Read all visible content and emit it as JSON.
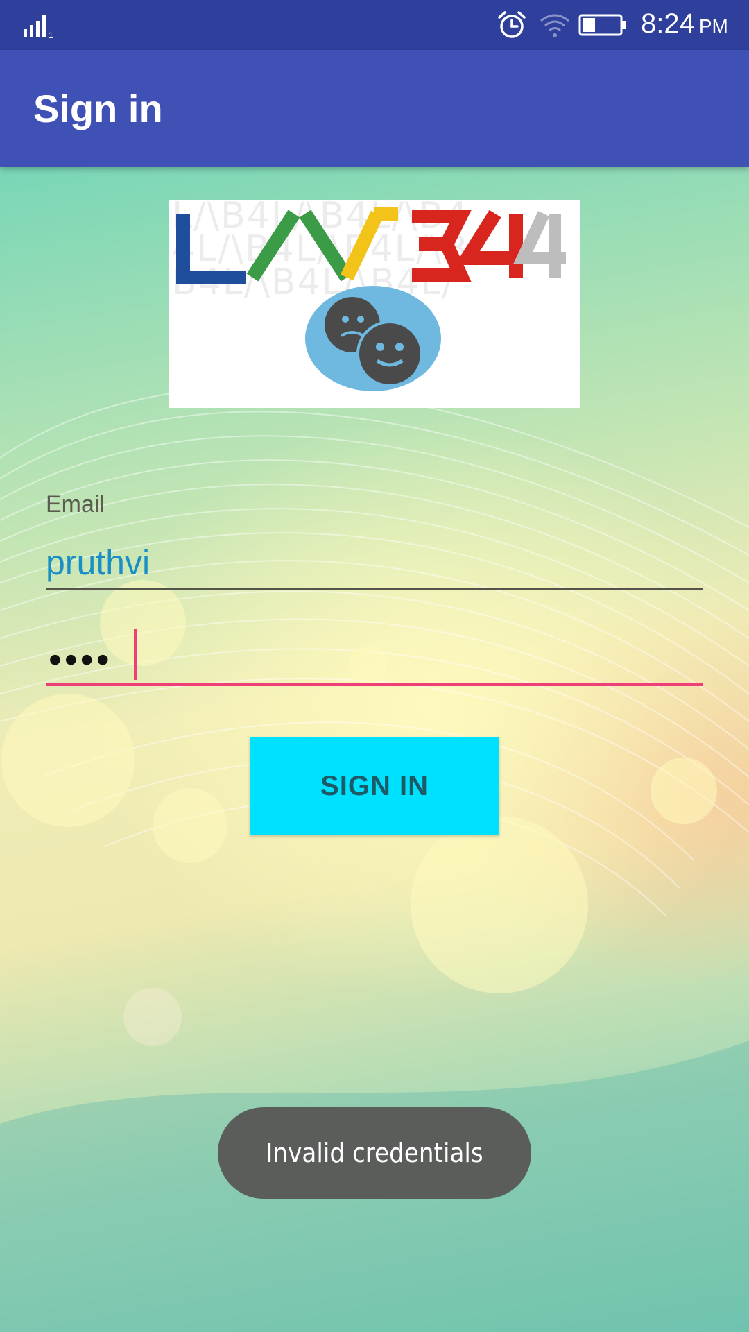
{
  "status_bar": {
    "time": "8:24",
    "ampm": "PM",
    "signal_label": "1",
    "icons": [
      "signal-icon",
      "alarm-icon",
      "wifi-icon",
      "battery-icon"
    ]
  },
  "app_bar": {
    "title": "Sign in"
  },
  "logo": {
    "text": "LAB4"
  },
  "form": {
    "email_label": "Email",
    "email_value": "pruthvi",
    "password_mask": "••••"
  },
  "sign_in_button": {
    "label": "SIGN IN"
  },
  "toast": {
    "message": "Invalid credentials"
  },
  "colors": {
    "status_bar": "#2f3f9c",
    "app_bar": "#3f51b5",
    "accent": "#ef3f79",
    "button": "#00e0ff",
    "email_text": "#1a8fc4",
    "toast": "#5b5d5b"
  }
}
